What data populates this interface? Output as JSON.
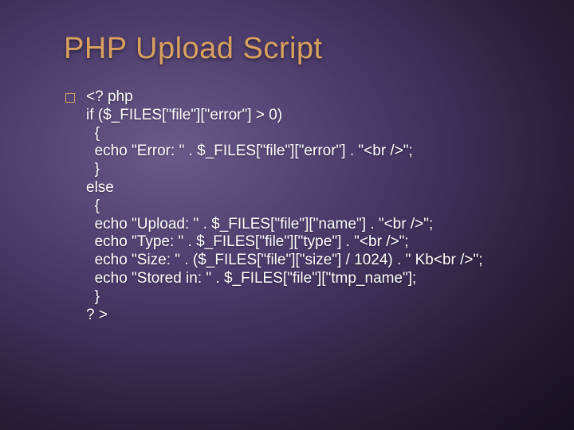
{
  "title": "PHP Upload Script",
  "bullet_icon": "square-outline-icon",
  "code": "<? php\nif ($_FILES[\"file\"][\"error\"] > 0)\n  {\n  echo \"Error: \" . $_FILES[\"file\"][\"error\"] . \"<br />\";\n  }\nelse\n  {\n  echo \"Upload: \" . $_FILES[\"file\"][\"name\"] . \"<br />\";\n  echo \"Type: \" . $_FILES[\"file\"][\"type\"] . \"<br />\";\n  echo \"Size: \" . ($_FILES[\"file\"][\"size\"] / 1024) . \" Kb<br />\";\n  echo \"Stored in: \" . $_FILES[\"file\"][\"tmp_name\"];\n  }\n? >"
}
